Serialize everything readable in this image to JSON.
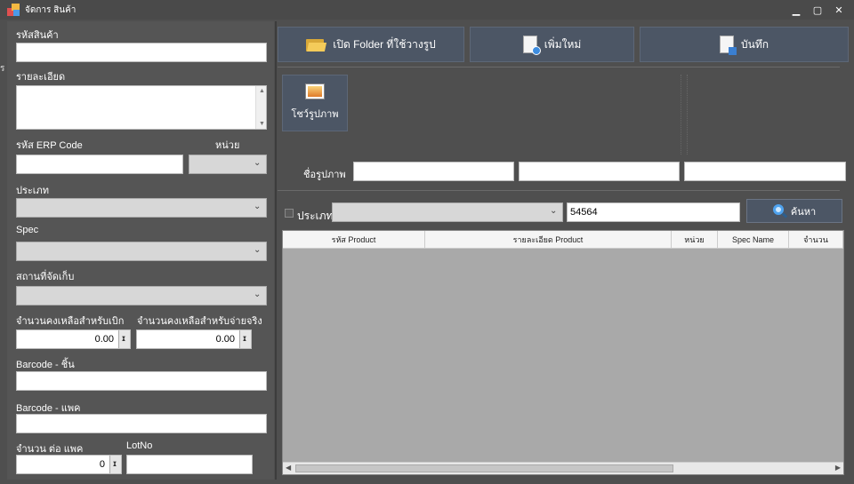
{
  "window": {
    "title": "จัดการ สินค้า",
    "controls": {
      "minimize": "▁",
      "maximize": "▢",
      "close": "✕"
    }
  },
  "left": {
    "product_code_label": "รหัสสินค้า",
    "product_code_value": "",
    "detail_label": "รายละเอียด",
    "detail_value": "",
    "erp_code_label": "รหัส ERP Code",
    "erp_code_value": "",
    "unit_label": "หน่วย",
    "unit_value": "",
    "type_label": "ประเภท",
    "type_value": "",
    "spec_label": "Spec",
    "spec_value": "",
    "location_label": "สถานที่จัดเก็บ",
    "location_value": "",
    "remain_withdraw_label": "จำนวนคงเหลือสำหรับเบิก",
    "remain_withdraw_value": "0.00",
    "remain_actual_label": "จำนวนคงเหลือสำหรับจ่ายจริง",
    "remain_actual_value": "0.00",
    "barcode_piece_label": "Barcode - ชิ้น",
    "barcode_piece_value": "",
    "barcode_pack_label": "Barcode - แพค",
    "barcode_pack_value": "",
    "qty_per_pack_label": "จำนวน ต่อ แพค",
    "qty_per_pack_value": "0",
    "lotno_label": "LotNo",
    "lotno_value": ""
  },
  "toolbar": {
    "open_folder_label": "เปิด Folder ที่ใช้วางรูป",
    "add_new_label": "เพิ่มใหม่",
    "save_label": "บันทึก"
  },
  "image": {
    "show_image_label": "โชว์รูปภาพ",
    "image_name_label": "ชื่อรูปภาพ",
    "image_name_values": [
      "",
      "",
      ""
    ]
  },
  "search": {
    "type_checkbox_label": "ประเภท",
    "type_value": "",
    "query_value": "54564",
    "search_button_label": "ค้นหา"
  },
  "grid": {
    "columns": [
      "รหัส Product",
      "รายละเอียด Product",
      "หน่วย",
      "Spec Name",
      "จำนวน"
    ]
  },
  "edge_text": "ร"
}
